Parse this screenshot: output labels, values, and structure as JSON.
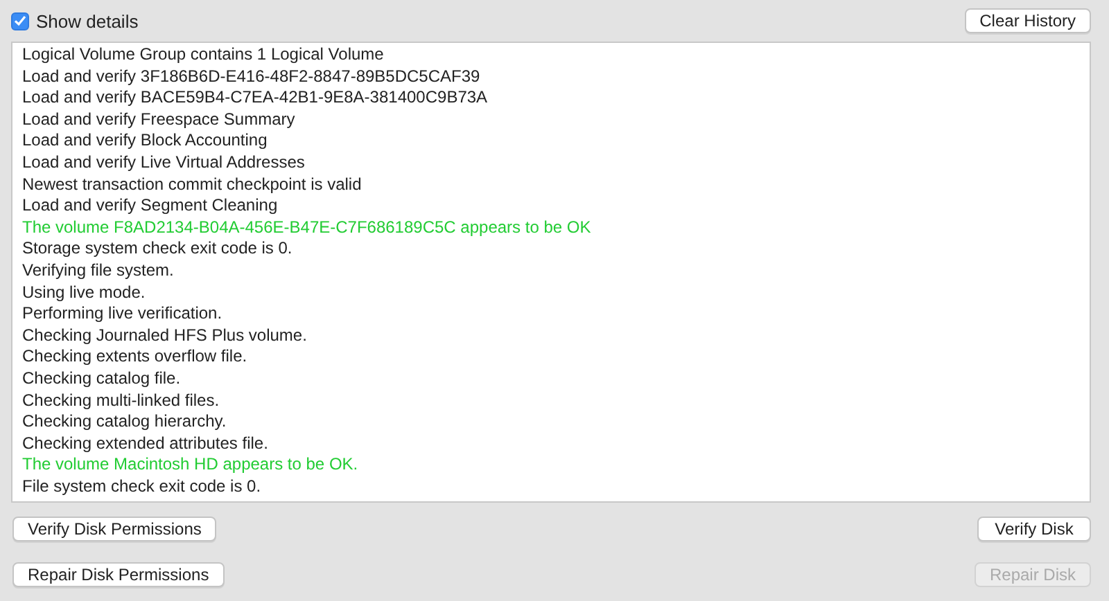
{
  "show_details": {
    "label": "Show details",
    "checked": true
  },
  "clear_history_button": {
    "label": "Clear History",
    "disabled": false
  },
  "log_lines": [
    {
      "text": "Logical Volume Group contains 1 Logical Volume",
      "kind": "info"
    },
    {
      "text": "Load and verify 3F186B6D-E416-48F2-8847-89B5DC5CAF39",
      "kind": "info"
    },
    {
      "text": "Load and verify BACE59B4-C7EA-42B1-9E8A-381400C9B73A",
      "kind": "info"
    },
    {
      "text": "Load and verify Freespace Summary",
      "kind": "info"
    },
    {
      "text": "Load and verify Block Accounting",
      "kind": "info"
    },
    {
      "text": "Load and verify Live Virtual Addresses",
      "kind": "info"
    },
    {
      "text": "Newest transaction commit checkpoint is valid",
      "kind": "info"
    },
    {
      "text": "Load and verify Segment Cleaning",
      "kind": "info"
    },
    {
      "text": "The volume F8AD2134-B04A-456E-B47E-C7F686189C5C appears to be OK",
      "kind": "success"
    },
    {
      "text": "Storage system check exit code is 0.",
      "kind": "info"
    },
    {
      "text": "Verifying file system.",
      "kind": "info"
    },
    {
      "text": "Using live mode.",
      "kind": "info"
    },
    {
      "text": "Performing live verification.",
      "kind": "info"
    },
    {
      "text": "Checking Journaled HFS Plus volume.",
      "kind": "info"
    },
    {
      "text": "Checking extents overflow file.",
      "kind": "info"
    },
    {
      "text": "Checking catalog file.",
      "kind": "info"
    },
    {
      "text": "Checking multi-linked files.",
      "kind": "info"
    },
    {
      "text": "Checking catalog hierarchy.",
      "kind": "info"
    },
    {
      "text": "Checking extended attributes file.",
      "kind": "info"
    },
    {
      "text": "The volume Macintosh HD appears to be OK.",
      "kind": "success"
    },
    {
      "text": "File system check exit code is 0.",
      "kind": "info"
    }
  ],
  "buttons": [
    {
      "label": "Verify Disk Permissions",
      "disabled": false
    },
    {
      "label": "Verify Disk",
      "disabled": false
    },
    {
      "label": "Repair Disk Permissions",
      "disabled": false
    },
    {
      "label": "Repair Disk",
      "disabled": true
    }
  ]
}
